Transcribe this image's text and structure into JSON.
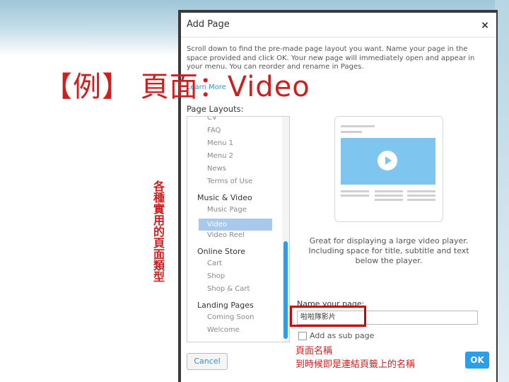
{
  "slide": {
    "title": "【例】 頁面：Video",
    "vertical_label": "各種實用的頁面類型"
  },
  "dialog": {
    "title": "Add Page",
    "close_label": "×",
    "intro": "Scroll down to find the pre-made page layout you want. Name your page in the space provided and click OK. Your new page will immediately open and appear in your menu. You can reorder and rename in Pages.",
    "learn_more": "Learn More",
    "layouts_label": "Page Layouts:",
    "layouts": [
      {
        "label": "CV",
        "type": "item"
      },
      {
        "label": "FAQ",
        "type": "item"
      },
      {
        "label": "Menu 1",
        "type": "item"
      },
      {
        "label": "Menu 2",
        "type": "item"
      },
      {
        "label": "News",
        "type": "item"
      },
      {
        "label": "Terms of Use",
        "type": "item"
      },
      {
        "label": "Music & Video",
        "type": "group"
      },
      {
        "label": "Music Page",
        "type": "item"
      },
      {
        "label": "Video",
        "type": "item",
        "selected": true
      },
      {
        "label": "Video Reel",
        "type": "item"
      },
      {
        "label": "Online Store",
        "type": "group"
      },
      {
        "label": "Cart",
        "type": "item"
      },
      {
        "label": "Shop",
        "type": "item"
      },
      {
        "label": "Shop & Cart",
        "type": "item"
      },
      {
        "label": "Landing Pages",
        "type": "group"
      },
      {
        "label": "Coming Soon",
        "type": "item"
      },
      {
        "label": "Welcome",
        "type": "item"
      }
    ],
    "preview_description": "Great for displaying a large video player. Including space for title, subtitle and text below the player.",
    "name_label": "Name your page:",
    "name_value": "啦啦隊影片",
    "sub_page_label": "Add as sub page",
    "cancel_label": "Cancel",
    "ok_label": "OK"
  },
  "annotations": {
    "note_line1": "頁面名稱",
    "note_line2": "到時候即是連結頁籤上的名稱"
  },
  "colors": {
    "annotation_red": "#cc1f1f",
    "accent_blue": "#2a9ee6",
    "selection": "#a9c9ec",
    "video_preview": "#7ec5f0"
  },
  "icons": {
    "close": "close-icon",
    "play": "play-icon",
    "checkbox": "checkbox-icon"
  }
}
